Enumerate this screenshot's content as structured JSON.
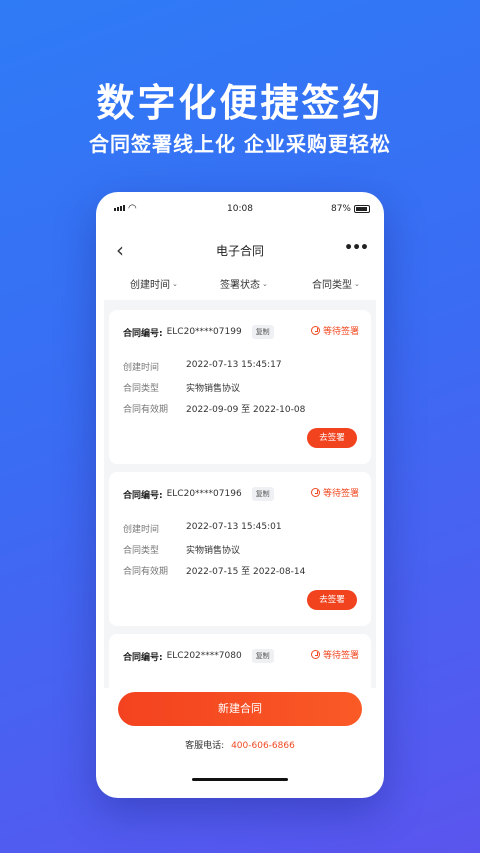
{
  "promo": {
    "title": "数字化便捷签约",
    "subtitle": "合同签署线上化 企业采购更轻松"
  },
  "status_bar": {
    "time": "10:08",
    "battery": "87%"
  },
  "nav": {
    "back_icon": "chevron-left-icon",
    "title": "电子合同",
    "more_icon": "more-icon"
  },
  "filters": [
    {
      "label": "创建时间"
    },
    {
      "label": "签署状态"
    },
    {
      "label": "合同类型"
    }
  ],
  "labels": {
    "contract_no": "合同编号:",
    "copy": "复制",
    "created": "创建时间",
    "type": "合同类型",
    "validity": "合同有效期",
    "sign": "去签署"
  },
  "contracts": [
    {
      "number": "ELC20****07199",
      "status": "等待签署",
      "created": "2022-07-13 15:45:17",
      "type": "实物销售协议",
      "validity": "2022-09-09 至 2022-10-08"
    },
    {
      "number": "ELC20****07196",
      "status": "等待签署",
      "created": "2022-07-13 15:45:01",
      "type": "实物销售协议",
      "validity": "2022-07-15 至 2022-08-14"
    },
    {
      "number": "ELC202****7080",
      "status": "等待签署"
    }
  ],
  "footer": {
    "new_button": "新建合同",
    "service_label": "客服电话:",
    "service_phone": "400-606-6866"
  },
  "colors": {
    "accent": "#f2431f",
    "background": "#3a6cf3"
  }
}
